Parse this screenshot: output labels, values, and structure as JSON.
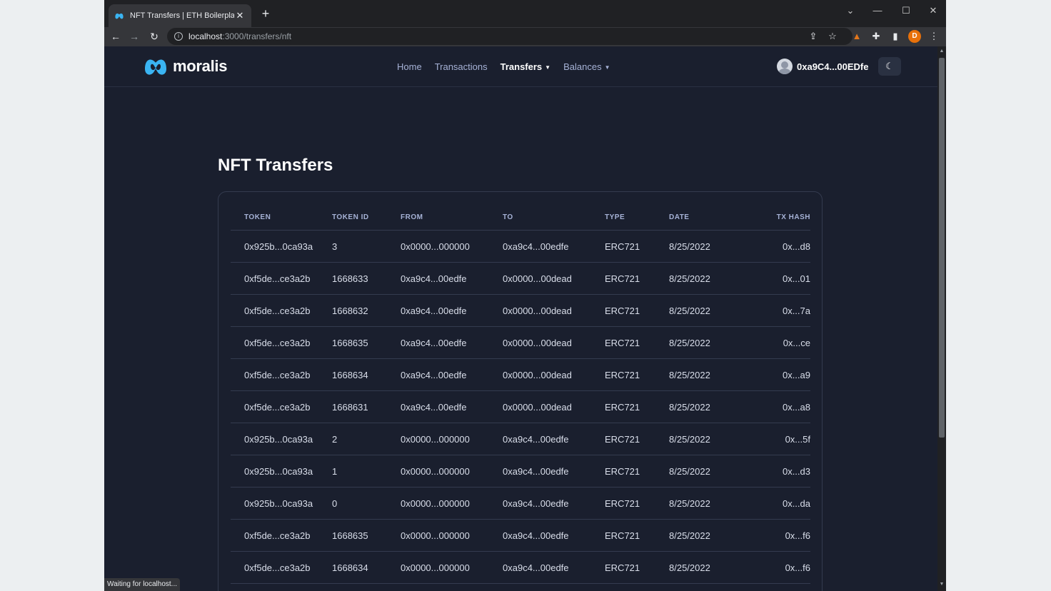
{
  "browser": {
    "tab_title": "NFT Transfers | ETH Boilerplate",
    "tab_close": "✕",
    "new_tab": "+",
    "url_host": "localhost",
    "url_path": ":3000/transfers/nft",
    "profile_initial": "D",
    "status_text": "Waiting for localhost..."
  },
  "header": {
    "logo_text": "moralis",
    "nav": [
      {
        "label": "Home"
      },
      {
        "label": "Transactions"
      },
      {
        "label": "Transfers",
        "active": true,
        "dropdown": true
      },
      {
        "label": "Balances",
        "dropdown": true
      }
    ],
    "account_address": "0xa9C4...00EDfe",
    "theme_icon": "moon-icon"
  },
  "main": {
    "title": "NFT Transfers",
    "columns": [
      "TOKEN",
      "TOKEN ID",
      "FROM",
      "TO",
      "TYPE",
      "DATE",
      "TX HASH"
    ],
    "rows": [
      [
        "0x925b...0ca93a",
        "3",
        "0x0000...000000",
        "0xa9c4...00edfe",
        "ERC721",
        "8/25/2022",
        "0x...d8"
      ],
      [
        "0xf5de...ce3a2b",
        "1668633",
        "0xa9c4...00edfe",
        "0x0000...00dead",
        "ERC721",
        "8/25/2022",
        "0x...01"
      ],
      [
        "0xf5de...ce3a2b",
        "1668632",
        "0xa9c4...00edfe",
        "0x0000...00dead",
        "ERC721",
        "8/25/2022",
        "0x...7a"
      ],
      [
        "0xf5de...ce3a2b",
        "1668635",
        "0xa9c4...00edfe",
        "0x0000...00dead",
        "ERC721",
        "8/25/2022",
        "0x...ce"
      ],
      [
        "0xf5de...ce3a2b",
        "1668634",
        "0xa9c4...00edfe",
        "0x0000...00dead",
        "ERC721",
        "8/25/2022",
        "0x...a9"
      ],
      [
        "0xf5de...ce3a2b",
        "1668631",
        "0xa9c4...00edfe",
        "0x0000...00dead",
        "ERC721",
        "8/25/2022",
        "0x...a8"
      ],
      [
        "0x925b...0ca93a",
        "2",
        "0x0000...000000",
        "0xa9c4...00edfe",
        "ERC721",
        "8/25/2022",
        "0x...5f"
      ],
      [
        "0x925b...0ca93a",
        "1",
        "0x0000...000000",
        "0xa9c4...00edfe",
        "ERC721",
        "8/25/2022",
        "0x...d3"
      ],
      [
        "0x925b...0ca93a",
        "0",
        "0x0000...000000",
        "0xa9c4...00edfe",
        "ERC721",
        "8/25/2022",
        "0x...da"
      ],
      [
        "0xf5de...ce3a2b",
        "1668635",
        "0x0000...000000",
        "0xa9c4...00edfe",
        "ERC721",
        "8/25/2022",
        "0x...f6"
      ],
      [
        "0xf5de...ce3a2b",
        "1668634",
        "0x0000...000000",
        "0xa9c4...00edfe",
        "ERC721",
        "8/25/2022",
        "0x...f6"
      ]
    ]
  },
  "colors": {
    "page_bg": "#1a1f2e",
    "logo_blue": "#3ab4f2",
    "nav_text": "#a6b2d6"
  }
}
